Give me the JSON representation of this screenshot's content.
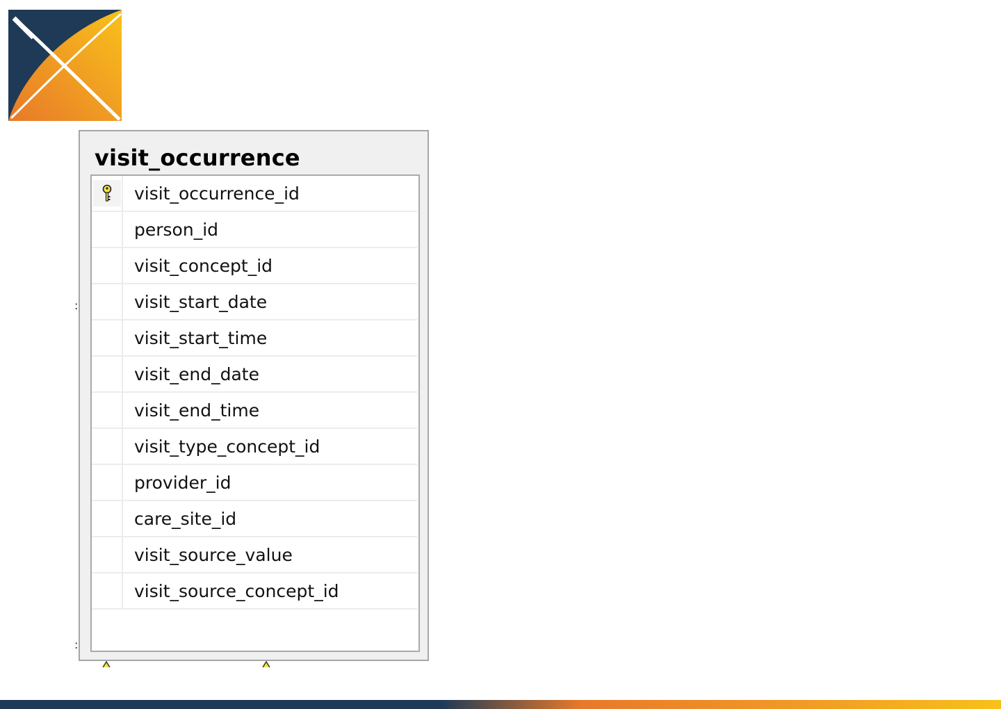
{
  "table": {
    "title": "visit_occurrence",
    "columns": [
      {
        "name": "visit_occurrence_id",
        "primary_key": true,
        "icon": "key-icon"
      },
      {
        "name": "person_id",
        "primary_key": false
      },
      {
        "name": "visit_concept_id",
        "primary_key": false
      },
      {
        "name": "visit_start_date",
        "primary_key": false
      },
      {
        "name": "visit_start_time",
        "primary_key": false
      },
      {
        "name": "visit_end_date",
        "primary_key": false
      },
      {
        "name": "visit_end_time",
        "primary_key": false
      },
      {
        "name": "visit_type_concept_id",
        "primary_key": false
      },
      {
        "name": "provider_id",
        "primary_key": false
      },
      {
        "name": "care_site_id",
        "primary_key": false
      },
      {
        "name": "visit_source_value",
        "primary_key": false
      },
      {
        "name": "visit_source_concept_id",
        "primary_key": false
      }
    ]
  },
  "colors": {
    "navy": "#1e3a56",
    "orange": "#f0841e",
    "yellow": "#f8c11a",
    "key_yellow": "#f2e34b"
  },
  "logo": {
    "icon": "ohdsi-logo"
  }
}
